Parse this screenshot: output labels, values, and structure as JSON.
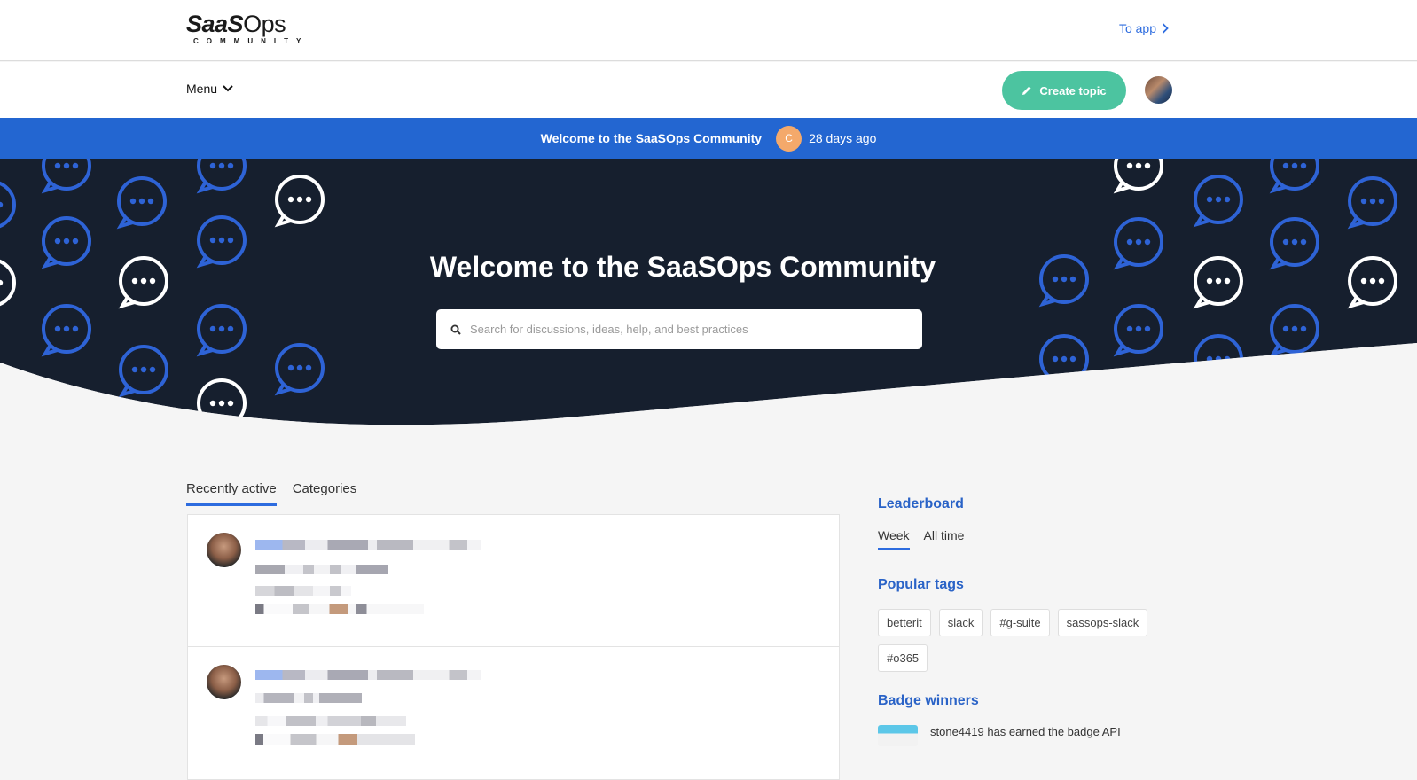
{
  "header": {
    "logo_main": "SaaS",
    "logo_thin": "Ops",
    "logo_sub": "COMMUNITY",
    "to_app_label": "To app"
  },
  "nav": {
    "menu_label": "Menu",
    "create_topic_label": "Create topic"
  },
  "banner": {
    "title": "Welcome to the SaaSOps Community",
    "avatar_letter": "C",
    "time": "28 days ago"
  },
  "hero": {
    "title": "Welcome to the SaaSOps Community",
    "search_placeholder": "Search for discussions, ideas, help, and best practices"
  },
  "tabs": {
    "recently_active": "Recently active",
    "categories": "Categories"
  },
  "sidebar": {
    "leaderboard_title": "Leaderboard",
    "leaderboard_tabs": [
      "Week",
      "All time"
    ],
    "popular_tags_title": "Popular tags",
    "tags": [
      "betterit",
      "slack",
      "#g-suite",
      "sassops-slack",
      "#o365"
    ],
    "badge_winners_title": "Badge winners",
    "badge_text": "stone4419 has earned the badge API"
  },
  "colors": {
    "accent_blue": "#2366d1",
    "create_button": "#4cc4a0",
    "hero_background": "#161f2e"
  }
}
